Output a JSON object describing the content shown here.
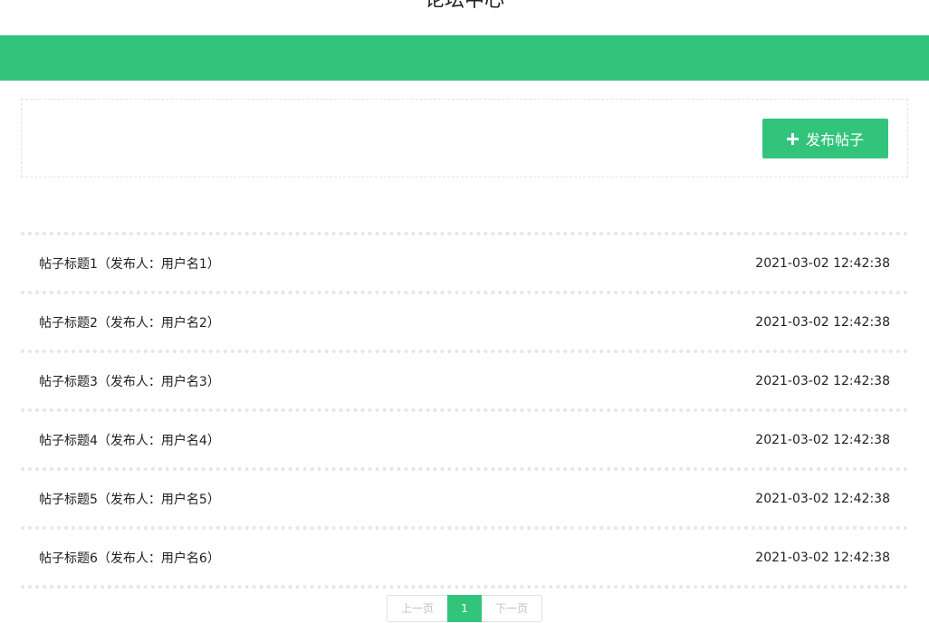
{
  "header": {
    "title": "论坛中心"
  },
  "toolbar": {
    "publish_label": "发布帖子"
  },
  "posts": [
    {
      "title": "帖子标题1（发布人：用户名1）",
      "time": "2021-03-02 12:42:38"
    },
    {
      "title": "帖子标题2（发布人：用户名2）",
      "time": "2021-03-02 12:42:38"
    },
    {
      "title": "帖子标题3（发布人：用户名3）",
      "time": "2021-03-02 12:42:38"
    },
    {
      "title": "帖子标题4（发布人：用户名4）",
      "time": "2021-03-02 12:42:38"
    },
    {
      "title": "帖子标题5（发布人：用户名5）",
      "time": "2021-03-02 12:42:38"
    },
    {
      "title": "帖子标题6（发布人：用户名6）",
      "time": "2021-03-02 12:42:38"
    }
  ],
  "pagination": {
    "prev_label": "上一页",
    "current_page": "1",
    "next_label": "下一页"
  },
  "colors": {
    "accent": "#33c47c",
    "divider": "#e6e6e6"
  },
  "icons": {
    "publish": "plus-icon"
  }
}
